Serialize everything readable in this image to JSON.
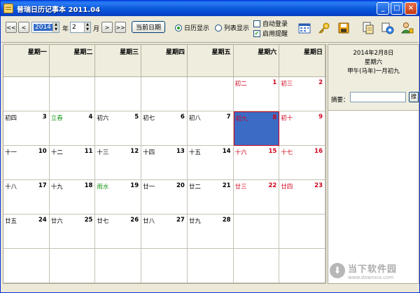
{
  "window": {
    "title": "普瑞日历记事本 2011.04"
  },
  "titlebar_buttons": {
    "minimize": "_",
    "maximize": "□",
    "close": "×"
  },
  "toolbar": {
    "first": "<<",
    "prev": "<",
    "next": ">",
    "last": ">>",
    "year_value": "2014",
    "year_label": "年",
    "month_value": "2",
    "month_label": "月",
    "today_button": "当前日期",
    "radio_calendar": "日历显示",
    "radio_list": "列表显示",
    "check_autologin": "自动登录",
    "check_reminder": "启用提醒"
  },
  "calendar": {
    "weekdays": [
      "星期一",
      "星期二",
      "星期三",
      "星期四",
      "星期五",
      "星期六",
      "星期日"
    ],
    "weeks": [
      [
        {
          "lunar": "",
          "num": ""
        },
        {
          "lunar": "",
          "num": ""
        },
        {
          "lunar": "",
          "num": ""
        },
        {
          "lunar": "",
          "num": ""
        },
        {
          "lunar": "",
          "num": ""
        },
        {
          "lunar": "初二",
          "num": "1"
        },
        {
          "lunar": "初三",
          "num": "2"
        }
      ],
      [
        {
          "lunar": "初四",
          "num": "3"
        },
        {
          "lunar": "立春",
          "num": "4"
        },
        {
          "lunar": "初六",
          "num": "5"
        },
        {
          "lunar": "初七",
          "num": "6"
        },
        {
          "lunar": "初八",
          "num": "7"
        },
        {
          "lunar": "初九",
          "num": "8"
        },
        {
          "lunar": "初十",
          "num": "9"
        }
      ],
      [
        {
          "lunar": "十一",
          "num": "10"
        },
        {
          "lunar": "十二",
          "num": "11"
        },
        {
          "lunar": "十三",
          "num": "12"
        },
        {
          "lunar": "十四",
          "num": "13"
        },
        {
          "lunar": "十五",
          "num": "14"
        },
        {
          "lunar": "十六",
          "num": "15"
        },
        {
          "lunar": "十七",
          "num": "16"
        }
      ],
      [
        {
          "lunar": "十八",
          "num": "17"
        },
        {
          "lunar": "十九",
          "num": "18"
        },
        {
          "lunar": "雨水",
          "num": "19"
        },
        {
          "lunar": "廿一",
          "num": "20"
        },
        {
          "lunar": "廿二",
          "num": "21"
        },
        {
          "lunar": "廿三",
          "num": "22"
        },
        {
          "lunar": "廿四",
          "num": "23"
        }
      ],
      [
        {
          "lunar": "廿五",
          "num": "24"
        },
        {
          "lunar": "廿六",
          "num": "25"
        },
        {
          "lunar": "廿七",
          "num": "26"
        },
        {
          "lunar": "廿八",
          "num": "27"
        },
        {
          "lunar": "廿九",
          "num": "28"
        },
        {
          "lunar": "",
          "num": ""
        },
        {
          "lunar": "",
          "num": ""
        }
      ],
      [
        {
          "lunar": "",
          "num": ""
        },
        {
          "lunar": "",
          "num": ""
        },
        {
          "lunar": "",
          "num": ""
        },
        {
          "lunar": "",
          "num": ""
        },
        {
          "lunar": "",
          "num": ""
        },
        {
          "lunar": "",
          "num": ""
        },
        {
          "lunar": "",
          "num": ""
        }
      ]
    ],
    "festival_days": [
      "4",
      "19"
    ],
    "selected_day": "8"
  },
  "panel": {
    "date": "2014年2月8日",
    "weekday": "星期六",
    "lunar": "甲午(马年)一月初九",
    "memo_label": "摘要：",
    "memo_value": "",
    "memo_button": "搜"
  },
  "watermark": {
    "cn": "当下软件园",
    "url": "www.downxia.com"
  },
  "colors": {
    "weekend_red": "#D0021B",
    "festival_green": "#1A9A1A",
    "selected_blue": "#3A6CC6",
    "titlebar_blue": "#0B59DC"
  },
  "icons": [
    "calendar-grid-icon",
    "key-icon",
    "save-disk-icon",
    "document-copy-icon",
    "settings-gear-icon",
    "user-icon"
  ]
}
